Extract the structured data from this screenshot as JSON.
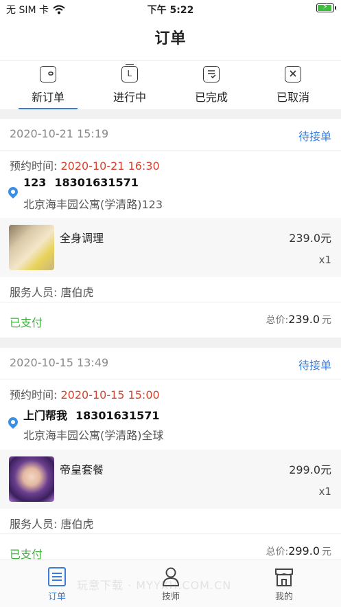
{
  "status_bar": {
    "carrier": "无 SIM 卡",
    "time": "下午 5:22",
    "battery_level": 0.85
  },
  "nav": {
    "title": "订单"
  },
  "tabs": [
    {
      "label": "新订单",
      "icon": "wallet-icon",
      "active": true
    },
    {
      "label": "进行中",
      "icon": "clock-icon",
      "active": false
    },
    {
      "label": "已完成",
      "icon": "check-list-icon",
      "active": false
    },
    {
      "label": "已取消",
      "icon": "x-box-icon",
      "active": false
    }
  ],
  "orders": [
    {
      "created": "2020-10-21 15:19",
      "status": "待接单",
      "appt_label": "预约时间:",
      "appt_time": "2020-10-21 16:30",
      "contact_name": "123",
      "phone": "18301631571",
      "address": "北京海丰园公寓(学清路)123",
      "product_name": "全身调理",
      "product_price": "239.0元",
      "product_qty": "x1",
      "staff_label": "服务人员:",
      "staff_name": "唐伯虎",
      "payment": "已支付",
      "total_label": "总价:",
      "total_value": "239.0",
      "total_unit": "元"
    },
    {
      "created": "2020-10-15 13:49",
      "status": "待接单",
      "appt_label": "预约时间:",
      "appt_time": "2020-10-15 15:00",
      "contact_name": "上门帮我",
      "phone": "18301631571",
      "address": "北京海丰园公寓(学清路)全球",
      "product_name": "帝皇套餐",
      "product_price": "299.0元",
      "product_qty": "x1",
      "staff_label": "服务人员:",
      "staff_name": "唐伯虎",
      "payment": "已支付",
      "total_label": "总价:",
      "total_value": "299.0",
      "total_unit": "元"
    }
  ],
  "bottom_nav": [
    {
      "label": "订单",
      "icon": "order-list-icon",
      "active": true
    },
    {
      "label": "技师",
      "icon": "person-icon",
      "active": false
    },
    {
      "label": "我的",
      "icon": "store-icon",
      "active": false
    }
  ],
  "watermark": "玩意下载 · MYYXH.COM.CN",
  "colors": {
    "accent": "#3a7bdc",
    "time_red": "#d64531",
    "paid_green": "#3fae3f"
  }
}
